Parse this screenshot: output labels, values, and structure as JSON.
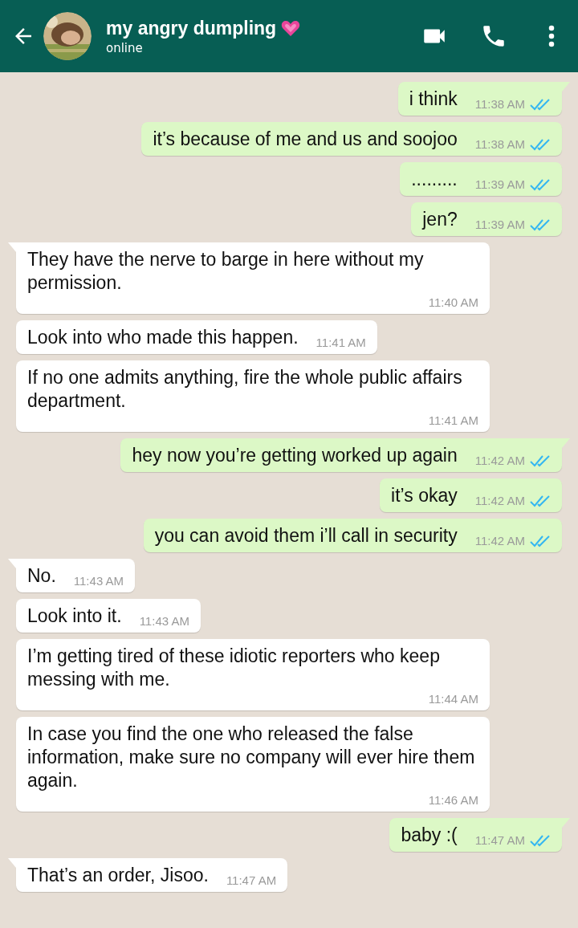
{
  "header": {
    "title": "my angry dumpling",
    "status": "online"
  },
  "messages": [
    {
      "kind": "outgoing",
      "tail": true,
      "text": "i think",
      "time": "11:38 AM",
      "read": true
    },
    {
      "kind": "outgoing",
      "tail": false,
      "text": "it’s because of me and us and soojoo",
      "time": "11:38 AM",
      "read": true
    },
    {
      "kind": "outgoing",
      "tail": false,
      "text": ".........",
      "time": "11:39 AM",
      "read": true
    },
    {
      "kind": "outgoing",
      "tail": false,
      "text": "jen?",
      "time": "11:39 AM",
      "read": true
    },
    {
      "kind": "incoming",
      "tail": true,
      "text": "They have the nerve to barge in here without my permission.",
      "time": "11:40 AM"
    },
    {
      "kind": "incoming",
      "tail": false,
      "text": "Look into who made this happen.",
      "time": "11:41 AM"
    },
    {
      "kind": "incoming",
      "tail": false,
      "text": "If no one admits anything, fire the whole public affairs department.",
      "time": "11:41 AM"
    },
    {
      "kind": "outgoing",
      "tail": true,
      "text": "hey now you’re getting worked up again",
      "time": "11:42 AM",
      "read": true
    },
    {
      "kind": "outgoing",
      "tail": false,
      "text": "it’s okay",
      "time": "11:42 AM",
      "read": true
    },
    {
      "kind": "outgoing",
      "tail": false,
      "text": "you can avoid them i’ll call in security",
      "time": "11:42 AM",
      "read": true
    },
    {
      "kind": "incoming",
      "tail": true,
      "text": "No.",
      "time": "11:43 AM"
    },
    {
      "kind": "incoming",
      "tail": false,
      "text": "Look into it.",
      "time": "11:43 AM"
    },
    {
      "kind": "incoming",
      "tail": false,
      "text": "I’m getting tired of these idiotic reporters who keep messing with me.",
      "time": "11:44 AM"
    },
    {
      "kind": "incoming",
      "tail": false,
      "text": "In case you find the one who released the false information, make sure no company will ever hire them again.",
      "time": "11:46 AM"
    },
    {
      "kind": "outgoing",
      "tail": true,
      "text": "baby :(",
      "time": "11:47 AM",
      "read": true
    },
    {
      "kind": "incoming",
      "tail": true,
      "text": "That’s an order, Jisoo.",
      "time": "11:47 AM"
    }
  ]
}
